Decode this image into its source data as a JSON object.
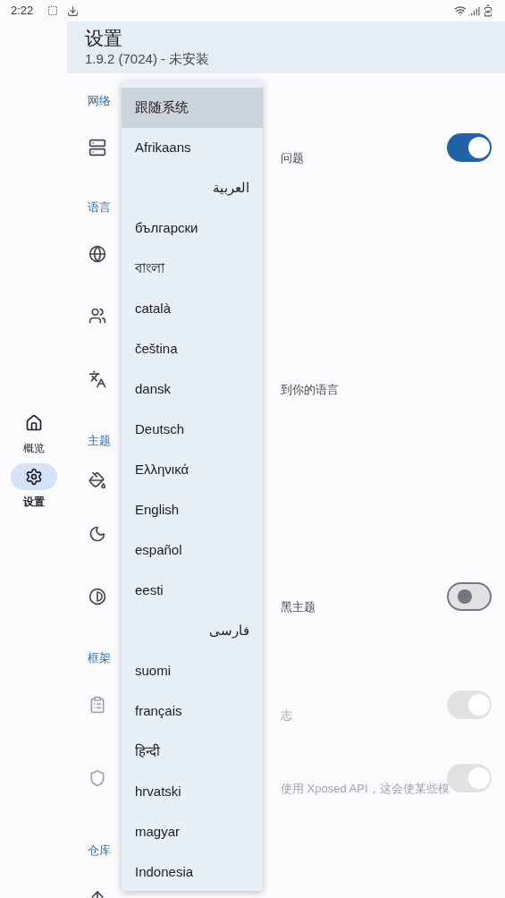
{
  "status_bar": {
    "time": "2:22"
  },
  "nav": [
    {
      "label": "概览",
      "selected": false
    },
    {
      "label": "设置",
      "selected": true
    }
  ],
  "header": {
    "title": "设置",
    "subtitle": "1.9.2 (7024) - 未安装"
  },
  "sections": [
    {
      "heading": "网络",
      "rows": [
        {
          "text": "问题",
          "disabled": false,
          "switch": {
            "on": true,
            "disabled": false
          }
        }
      ]
    },
    {
      "heading": "语言",
      "rows": [
        {
          "disabled": false
        },
        {
          "disabled": false
        },
        {
          "text": "到你的语言",
          "disabled": false
        }
      ]
    },
    {
      "heading": "主题",
      "rows": [
        {
          "disabled": false
        },
        {
          "disabled": false
        },
        {
          "text": "黑主题",
          "disabled": false,
          "switch": {
            "on": false,
            "disabled": false
          }
        }
      ]
    },
    {
      "heading": "框架",
      "rows": [
        {
          "text": "志",
          "disabled": true,
          "switch": {
            "on": true,
            "disabled": true
          }
        },
        {
          "text": "使用 Xposed API，这会使某些模",
          "disabled": true,
          "switch": {
            "on": true,
            "disabled": true
          }
        }
      ]
    },
    {
      "heading": "仓库",
      "rows": [
        {
          "disabled": false
        }
      ]
    }
  ],
  "menu": [
    {
      "label": "跟随系统",
      "selected": true
    },
    {
      "label": "Afrikaans",
      "selected": false
    },
    {
      "label": "العربية",
      "selected": false
    },
    {
      "label": "български",
      "selected": false
    },
    {
      "label": "বাংলা",
      "selected": false
    },
    {
      "label": "català",
      "selected": false
    },
    {
      "label": "čeština",
      "selected": false
    },
    {
      "label": "dansk",
      "selected": false
    },
    {
      "label": "Deutsch",
      "selected": false
    },
    {
      "label": "Ελληνικά",
      "selected": false
    },
    {
      "label": "English",
      "selected": false
    },
    {
      "label": "español",
      "selected": false
    },
    {
      "label": "eesti",
      "selected": false
    },
    {
      "label": "فارسی",
      "selected": false
    },
    {
      "label": "suomi",
      "selected": false
    },
    {
      "label": "français",
      "selected": false
    },
    {
      "label": "हिन्दी",
      "selected": false
    },
    {
      "label": "hrvatski",
      "selected": false
    },
    {
      "label": "magyar",
      "selected": false
    },
    {
      "label": "Indonesia",
      "selected": false
    }
  ]
}
